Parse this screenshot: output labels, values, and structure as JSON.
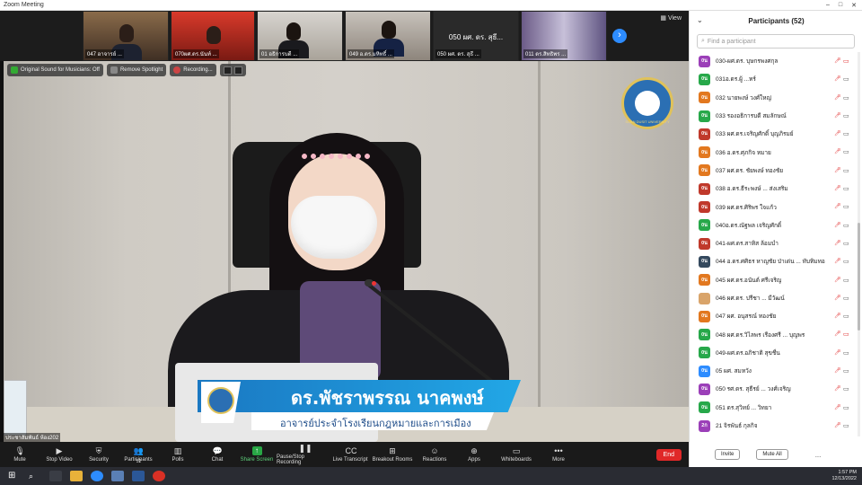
{
  "window": {
    "title": "Zoom Meeting",
    "controls": [
      "–",
      "□",
      "✕"
    ]
  },
  "thumbnails": [
    {
      "label": "047 อาจารย์ ..."
    },
    {
      "label": "070ผศ.ดร.นันท์ ..."
    },
    {
      "label": "01 อธิการบดี ..."
    },
    {
      "label": "049 อ.ดร.มหิทธิ์ ..."
    },
    {
      "label": "050 ผศ. ดร. สุธี ...",
      "center": "050 ผศ. ดร. สุธี..."
    },
    {
      "label": "011 ดร.สิทธิพร ..."
    }
  ],
  "view_label": "View",
  "pills": [
    "Original Sound for Musicians: Off",
    "Remove Spotlight",
    "Recording..."
  ],
  "lower_third": {
    "name": "ดร.พัชราพรรณ นาคพงษ์",
    "title": "อาจารย์ประจำโรงเรียนกฎหมายและการเมือง"
  },
  "self_name": "ประชาสัมพันธ์ ห้อง202",
  "logo_text": "SUAN DUSIT UNIVERSITY",
  "toolbar": [
    {
      "label": "Mute",
      "icon": "microphone-icon"
    },
    {
      "label": "Stop Video",
      "icon": "video-camera-icon"
    },
    {
      "label": "Security",
      "icon": "shield-icon"
    },
    {
      "label": "Participants",
      "icon": "participants-icon",
      "count": "52"
    },
    {
      "label": "Polls",
      "icon": "polls-icon"
    },
    {
      "label": "Chat",
      "icon": "chat-icon"
    },
    {
      "label": "Share Screen",
      "icon": "share-screen-icon"
    },
    {
      "label": "Pause/Stop Recording",
      "icon": "recording-icon"
    },
    {
      "label": "Live Transcript",
      "icon": "cc-icon"
    },
    {
      "label": "Breakout Rooms",
      "icon": "breakout-rooms-icon"
    },
    {
      "label": "Reactions",
      "icon": "reactions-icon"
    },
    {
      "label": "Apps",
      "icon": "apps-icon"
    },
    {
      "label": "Whiteboards",
      "icon": "whiteboard-icon"
    },
    {
      "label": "More",
      "icon": "more-icon"
    }
  ],
  "end_label": "End",
  "participants": {
    "header": "Participants (52)",
    "search_placeholder": "Find a participant",
    "items": [
      {
        "avatar": "0น",
        "color": "#9b3fb8",
        "name": "030-ผศ.ดร. บุษกรพงศกุล",
        "cam_red": true
      },
      {
        "avatar": "0น",
        "color": "#27a84a",
        "name": "031อ.ดร.ผู้ ...ทร์",
        "cam_red": false
      },
      {
        "avatar": "0น",
        "color": "#e2781f",
        "name": "032 นายพงษ์ วงศ์ใหญ่",
        "cam_red": false
      },
      {
        "avatar": "0น",
        "color": "#27a84a",
        "name": "033 รองอธิการบดี สมลักษณ์",
        "cam_red": false
      },
      {
        "avatar": "0น",
        "color": "#c0392b",
        "name": "033 ผศ.ดร.เจริญศักดิ์ บุญภิรมย์",
        "cam_red": false
      },
      {
        "avatar": "0น",
        "color": "#e2781f",
        "name": "036 อ.ดร.ศุภกิจ หมาย",
        "cam_red": false
      },
      {
        "avatar": "0น",
        "color": "#e2781f",
        "name": "037 ผศ.ดร. ชัยพงษ์ ทองชัย",
        "cam_red": false
      },
      {
        "avatar": "0น",
        "color": "#c0392b",
        "name": "038 อ.ดร.ธีระพงษ์ ... ส่งเสริม",
        "cam_red": false
      },
      {
        "avatar": "0น",
        "color": "#c0392b",
        "name": "039 ผศ.ดร.ศิริพร ใจแก้ว",
        "cam_red": false
      },
      {
        "avatar": "0น",
        "color": "#27a84a",
        "name": "040อ.ดร.ณัฐพล เจริญศักดิ์",
        "cam_red": false
      },
      {
        "avatar": "0น",
        "color": "#c0392b",
        "name": "041-ผศ.ดร.สาทิส ล้อมบำ",
        "cam_red": false
      },
      {
        "avatar": "0น",
        "color": "#34495e",
        "name": "044 อ.ดร.ศศิธร หาญชัย ป่าเด่น ... ทับทิมทอง",
        "cam_red": false
      },
      {
        "avatar": "0น",
        "color": "#e2781f",
        "name": "045 ผศ.ดร.อนันต์ ศรีเจริญ",
        "cam_red": false
      },
      {
        "avatar": "img",
        "color": "#d9a46a",
        "name": "046 ผศ.ดร. ปรีชา ... มีวัฒน์",
        "cam_red": false
      },
      {
        "avatar": "0น",
        "color": "#e2781f",
        "name": "047 ผศ. อนุสรณ์ ทองชัย",
        "cam_red": false
      },
      {
        "avatar": "0น",
        "color": "#27a84a",
        "name": "048 ผศ.ดร.วิไลพร เรืองศรี ... บุญพร",
        "cam_red": true
      },
      {
        "avatar": "0น",
        "color": "#27a84a",
        "name": "049-ผศ.ดร.อภิชาติ สุขชื่น",
        "cam_red": false
      },
      {
        "avatar": "0น",
        "color": "#2d8cff",
        "name": "05 ผศ. สมหวัง",
        "cam_red": false
      },
      {
        "avatar": "0น",
        "color": "#9b3fb8",
        "name": "050 รศ.ดร. สุธีรย์ ... วงศ์เจริญ",
        "cam_red": false
      },
      {
        "avatar": "0น",
        "color": "#27a84a",
        "name": "051 ดร.สุวิทย์ ... วิทยา",
        "cam_red": false
      },
      {
        "avatar": "2ก",
        "color": "#9b3fb8",
        "name": "21 จิรพันธ์ กุลกิจ",
        "cam_red": false
      }
    ],
    "footer": {
      "invite": "Invite",
      "mute_all": "Mute All",
      "more": "..."
    }
  },
  "clock": {
    "time": "1:57 PM",
    "date": "12/13/2022"
  },
  "colors": {
    "accent": "#2d8cff",
    "end": "#e02828",
    "share": "#28a745"
  }
}
